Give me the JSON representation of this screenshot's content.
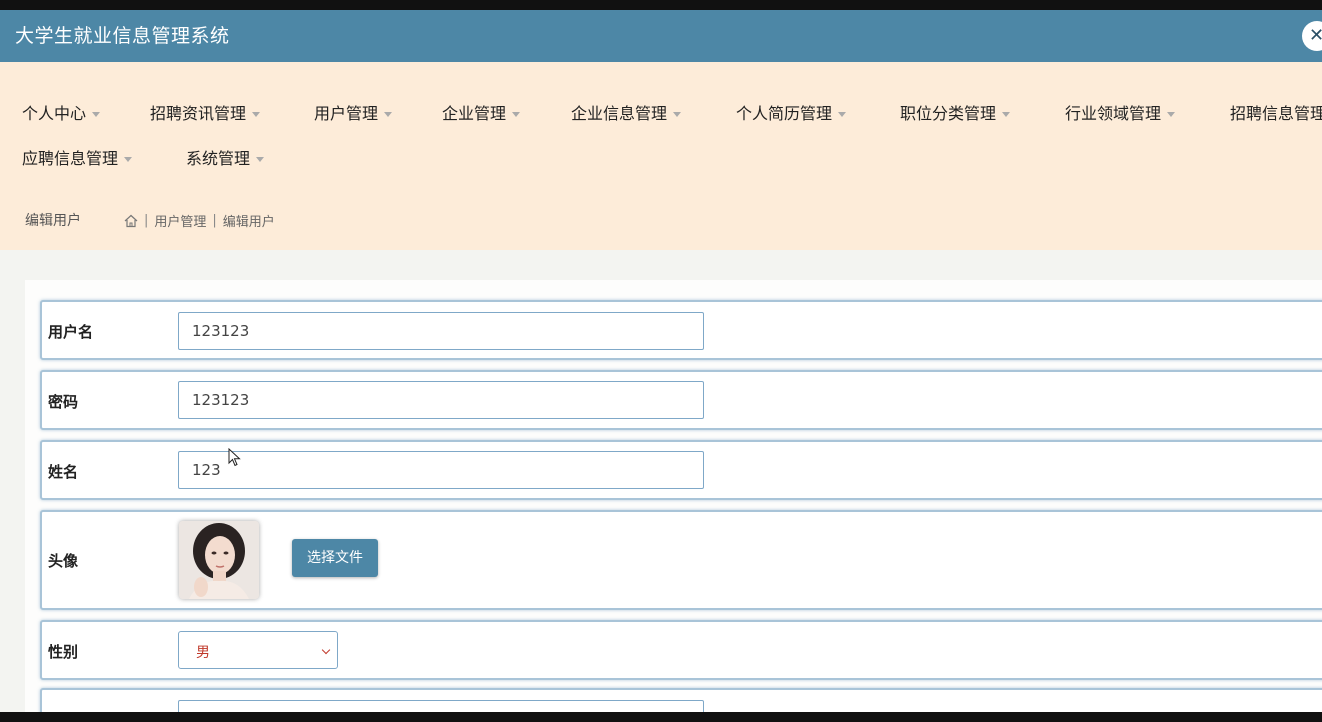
{
  "app": {
    "title": "大学生就业信息管理系统",
    "close_label": "✕"
  },
  "nav": {
    "items": [
      {
        "label": "个人中心"
      },
      {
        "label": "招聘资讯管理"
      },
      {
        "label": "用户管理"
      },
      {
        "label": "企业管理"
      },
      {
        "label": "企业信息管理"
      },
      {
        "label": "个人简历管理"
      },
      {
        "label": "职位分类管理"
      },
      {
        "label": "行业领域管理"
      },
      {
        "label": "招聘信息管理"
      },
      {
        "label": "应聘信息管理"
      },
      {
        "label": "系统管理"
      }
    ]
  },
  "page": {
    "heading": "编辑用户",
    "breadcrumb": [
      "用户管理",
      "编辑用户"
    ]
  },
  "form": {
    "username": {
      "label": "用户名",
      "value": "123123"
    },
    "password": {
      "label": "密码",
      "value": "123123"
    },
    "name": {
      "label": "姓名",
      "value": "123"
    },
    "avatar": {
      "label": "头像",
      "button_label": "选择文件"
    },
    "gender": {
      "label": "性别",
      "value": "男"
    }
  },
  "colors": {
    "titlebar": "#4d87a6",
    "nav_bg": "#fdecd9",
    "accent": "#4d87a6"
  }
}
